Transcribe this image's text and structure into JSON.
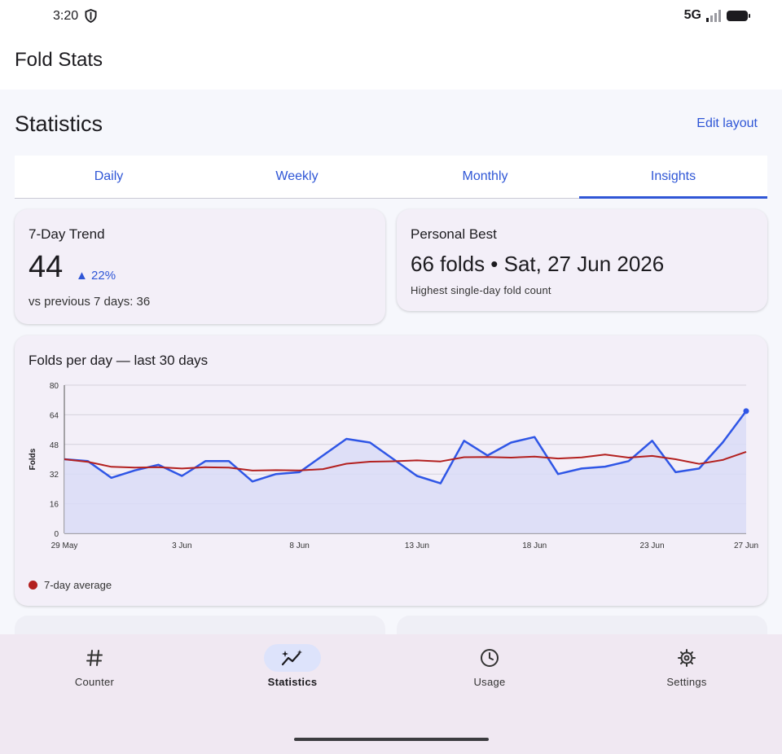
{
  "status_bar": {
    "time": "3:20",
    "network": "5G"
  },
  "app_bar": {
    "title": "Fold Stats"
  },
  "page": {
    "heading": "Statistics",
    "edit_layout_label": "Edit layout"
  },
  "tabs": [
    {
      "label": "Daily",
      "active": false
    },
    {
      "label": "Weekly",
      "active": false
    },
    {
      "label": "Monthly",
      "active": false
    },
    {
      "label": "Insights",
      "active": true
    }
  ],
  "trend_card": {
    "title": "7-Day Trend",
    "value": "44",
    "delta": "▲ 22%",
    "subtitle": "vs previous 7 days: 36"
  },
  "best_card": {
    "title": "Personal Best",
    "value": "66 folds • Sat, 27 Jun 2026",
    "subtitle": "Highest single-day fold count"
  },
  "chart_card": {
    "title": "Folds per day — last 30 days",
    "legend_label": "7-day average"
  },
  "chart_data": {
    "type": "line",
    "title": "Folds per day — last 30 days",
    "xlabel": "",
    "ylabel": "Folds",
    "ylim": [
      0,
      80
    ],
    "yticks": [
      0,
      16,
      32,
      48,
      64,
      80
    ],
    "xticks": [
      {
        "day": 0,
        "label": "29 May"
      },
      {
        "day": 5,
        "label": "3 Jun"
      },
      {
        "day": 10,
        "label": "8 Jun"
      },
      {
        "day": 15,
        "label": "13 Jun"
      },
      {
        "day": 20,
        "label": "18 Jun"
      },
      {
        "day": 25,
        "label": "23 Jun"
      },
      {
        "day": 29,
        "label": "27 Jun"
      }
    ],
    "grid": true,
    "legend_position": "bottom-left",
    "series": [
      {
        "color": "#2f56e6",
        "fill": "#d9dcf7",
        "values": [
          40,
          39,
          30,
          34,
          37,
          31,
          39,
          39,
          28,
          32,
          33,
          42,
          51,
          49,
          40,
          31,
          27,
          50,
          42,
          49,
          52,
          32,
          35,
          36,
          39,
          50,
          33,
          35,
          49,
          66
        ]
      },
      {
        "name": "7-day average",
        "color": "#b3201f",
        "values": [
          40,
          38.6,
          35.9,
          35.5,
          35.7,
          35,
          35.7,
          35.5,
          33.9,
          34.1,
          34,
          34.7,
          37.6,
          38.7,
          38.9,
          39.4,
          38.8,
          41.1,
          41.2,
          40.9,
          41.4,
          40.4,
          41,
          42.5,
          40.9,
          41.8,
          40,
          37.5,
          39.6,
          44
        ]
      }
    ]
  },
  "bottom_nav": [
    {
      "label": "Counter",
      "icon": "hash-icon",
      "active": false
    },
    {
      "label": "Statistics",
      "icon": "sparkle-trend-icon",
      "active": true
    },
    {
      "label": "Usage",
      "icon": "clock-icon",
      "active": false
    },
    {
      "label": "Settings",
      "icon": "gear-icon",
      "active": false
    }
  ],
  "colors": {
    "accent": "#2f56d6",
    "average_line": "#b3201f",
    "card_bg": "#f3eff8"
  }
}
